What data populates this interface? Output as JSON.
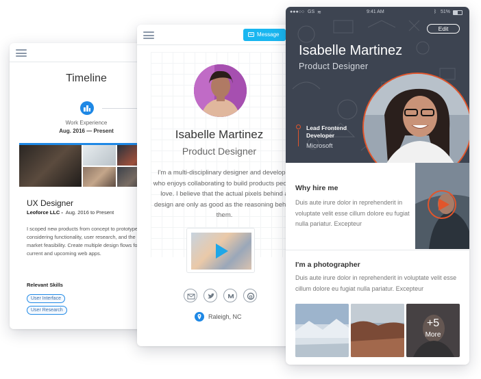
{
  "timeline_card": {
    "title": "Timeline",
    "milestone_label": "Work Experience",
    "milestone_date": "Aug. 2016 — Present",
    "job_title": "UX Designer",
    "company": "Leoforce LLC -",
    "company_dates": "Aug. 2016 to Present",
    "description": "I scoped new products from concept to prototype, considering functionality, user research, and the market feasibility. Create multiple design flows for current and upcoming web apps.",
    "skills_heading": "Relevant Skills",
    "skills": [
      "User Interface",
      "User Research"
    ]
  },
  "profile_card": {
    "message_button": "Message",
    "name": "Isabelle Martinez",
    "title": "Product Designer",
    "bio": "I'm a multi-disciplinary designer and developer who enjoys collaborating to build products people love. I believe that the actual pixels behind a design are only as good as the reasoning behind them.",
    "social_icons": [
      "email-icon",
      "twitter-icon",
      "medium-icon",
      "github-icon"
    ],
    "location": "Raleigh, NC"
  },
  "mobile_card": {
    "status": {
      "carrier": "GS",
      "time": "9:41 AM",
      "battery": "51%"
    },
    "edit_button": "Edit",
    "name": "Isabelle Martinez",
    "role": "Product Designer",
    "current_role": "Lead Frontend Developer",
    "current_company": "Microsoft",
    "why_hire": {
      "heading": "Why hire me",
      "text": "Duis aute irure dolor in reprehenderit in voluptate velit esse cillum dolore eu fugiat nulla pariatur. Excepteur"
    },
    "photographer": {
      "heading": "I'm a photographer",
      "text": "Duis aute irure dolor in reprehenderit in voluptate velit esse cillum dolore eu fugiat nulla pariatur. Excepteur",
      "more_count": "+5",
      "more_label": "More"
    }
  },
  "colors": {
    "accent_blue": "#1e88e5",
    "message_blue": "#19b6f0",
    "accent_orange": "#e2552b",
    "hero_dark": "#3d4451"
  }
}
